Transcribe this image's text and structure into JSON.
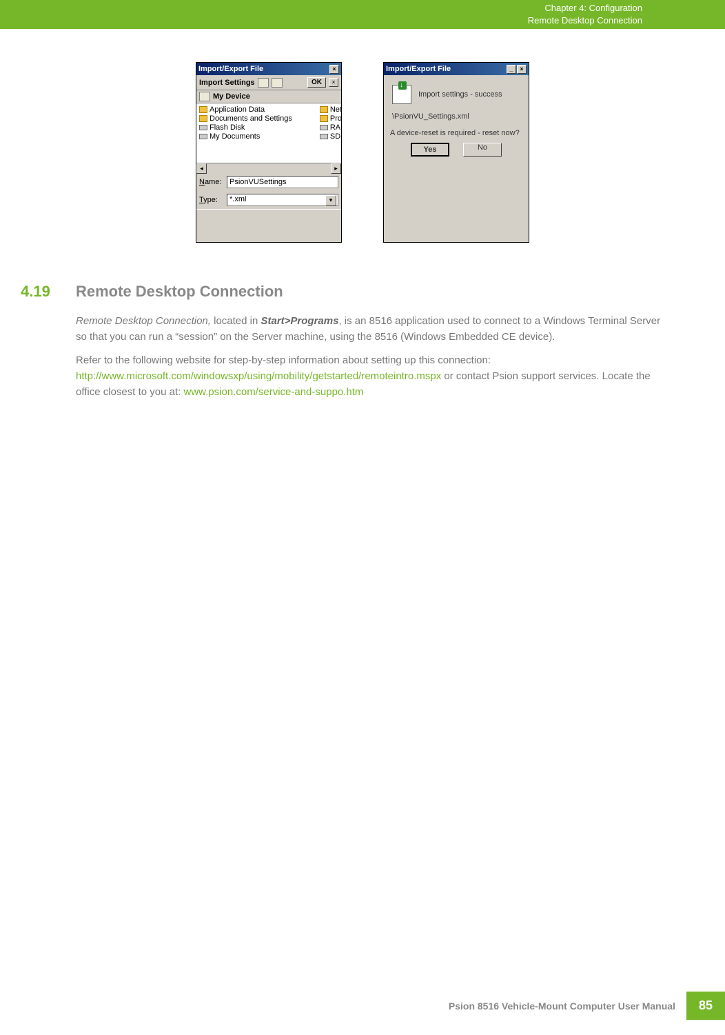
{
  "header": {
    "line1": "Chapter 4:  Configuration",
    "line2": "Remote Desktop Connection"
  },
  "dialog1": {
    "title": "Import/Export File",
    "toolbar_label": "Import Settings",
    "ok_label": "OK",
    "close_x": "×",
    "device_label": "My Device",
    "files_left": [
      "Application Data",
      "Documents and Settings",
      "Flash Disk",
      "My Documents"
    ],
    "files_right": [
      "Netwo",
      "Progra",
      "RAM D",
      "SD-MN"
    ],
    "name_label": "Name:",
    "name_value": "PsionVUSettings",
    "type_label": "Type:",
    "type_value": "*.xml"
  },
  "dialog2": {
    "title": "Import/Export File",
    "minimize": "_",
    "close_x": "×",
    "success_msg": "Import settings - success",
    "path": "\\PsionVU_Settings.xml",
    "reset_msg": "A device-reset is required - reset now?",
    "yes": "Yes",
    "no": "No"
  },
  "section": {
    "num": "4.19",
    "title": "Remote Desktop Connection",
    "p1_italic": "Remote Desktop Connection,",
    "p1_a": " located in ",
    "p1_bold": "Start>Programs",
    "p1_b": ", is an 8516 application used to connect to a Windows Terminal Server so that you can run a “session” on the Server machine, using the 8516 (Windows Embedded CE device).",
    "p2_a": "Refer to the following website for step-by-step information about setting up this connection: ",
    "p2_link1": "http://www.microsoft.com/windowsxp/using/mobility/getstarted/remoteintro.mspx",
    "p2_b": " or contact Psion support services. Locate the office closest to you at: ",
    "p2_link2": "www.psion.com/service-and-suppo.htm"
  },
  "footer": {
    "text": "Psion 8516 Vehicle-Mount Computer User Manual",
    "page": "85"
  }
}
